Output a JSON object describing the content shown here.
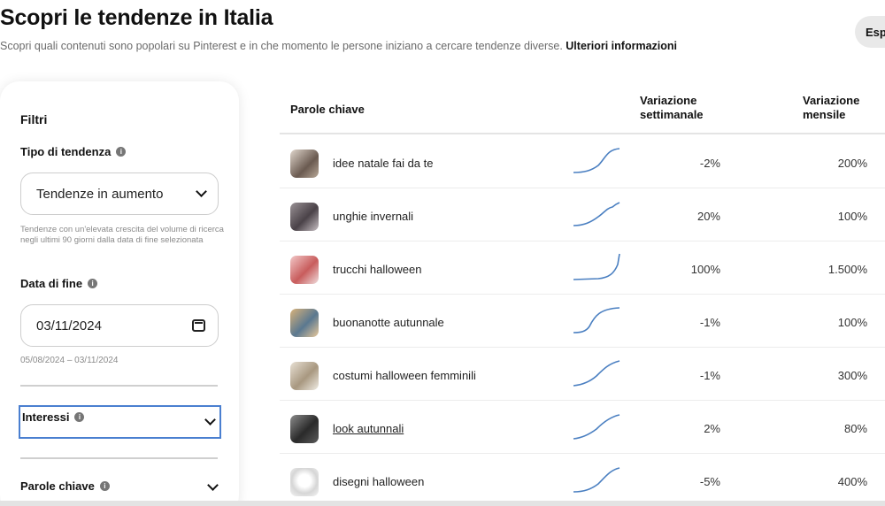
{
  "header": {
    "title": "Scopri le tendenze in Italia",
    "subtitle": "Scopri quali contenuti sono popolari su Pinterest e in che momento le persone iniziano a cercare tendenze diverse.",
    "more_link": "Ulteriori informazioni",
    "export_label": "Esp"
  },
  "filters": {
    "title": "Filtri",
    "trend_type": {
      "label": "Tipo di tendenza",
      "value": "Tendenze in aumento",
      "help": "Tendenze con un'elevata crescita del volume di ricerca negli ultimi 90 giorni dalla data di fine selezionata"
    },
    "end_date": {
      "label": "Data di fine",
      "value": "03/11/2024",
      "range": "05/08/2024 – 03/11/2024"
    },
    "interests_label": "Interessi",
    "keywords_label": "Parole chiave"
  },
  "table": {
    "headers": {
      "keywords": "Parole chiave",
      "weekly": "Variazione settimanale",
      "monthly": "Variazione mensile"
    },
    "rows": [
      {
        "keyword": "idee natale fai da te",
        "weekly": "-2%",
        "monthly": "200%"
      },
      {
        "keyword": "unghie invernali",
        "weekly": "20%",
        "monthly": "100%"
      },
      {
        "keyword": "trucchi halloween",
        "weekly": "100%",
        "monthly": "1.500%"
      },
      {
        "keyword": "buonanotte autunnale",
        "weekly": "-1%",
        "monthly": "100%"
      },
      {
        "keyword": "costumi halloween femminili",
        "weekly": "-1%",
        "monthly": "300%"
      },
      {
        "keyword": "look autunnali",
        "weekly": "2%",
        "monthly": "80%"
      },
      {
        "keyword": "disegni halloween",
        "weekly": "-5%",
        "monthly": "400%"
      }
    ]
  },
  "icons": {
    "info": "info-icon",
    "chevron": "chevron-down-icon",
    "calendar": "calendar-icon"
  },
  "colors": {
    "sparkline": "#4a7fc1",
    "focus_outline": "#4a7fd0",
    "subtitle_text": "#6b6b6b"
  }
}
